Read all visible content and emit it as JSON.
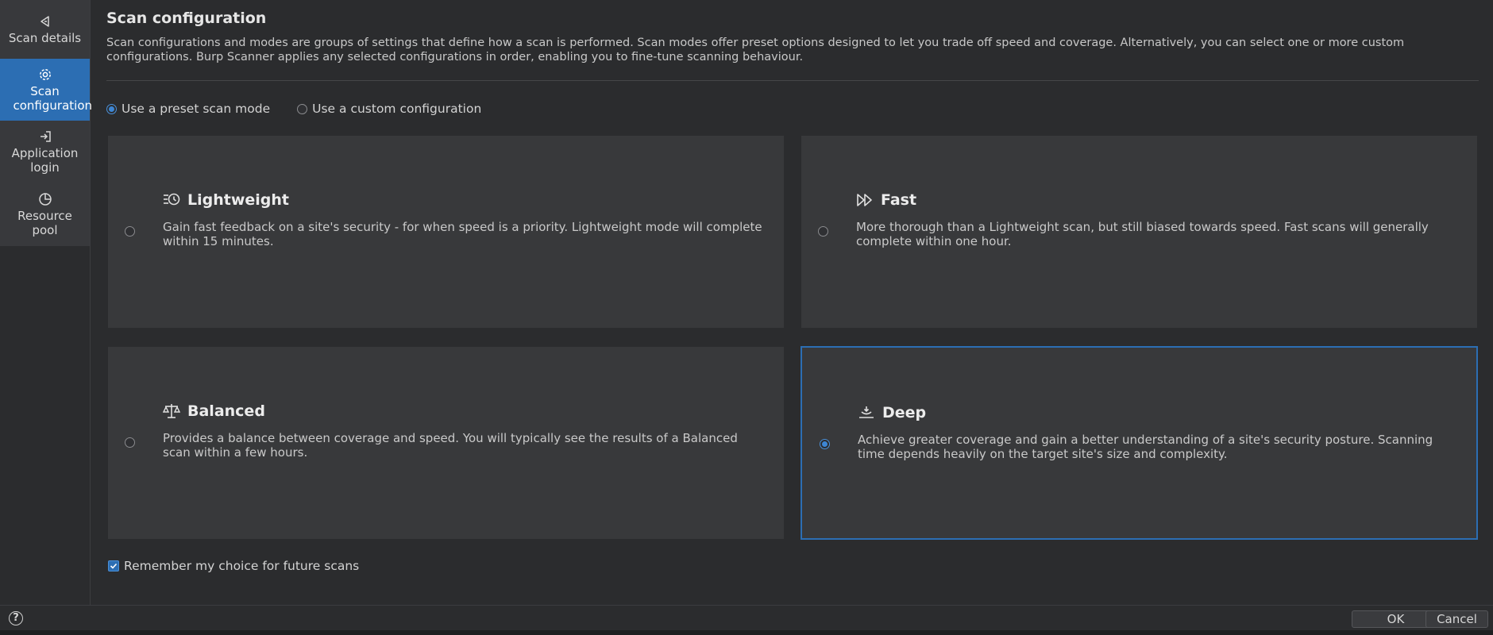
{
  "sidebar": {
    "items": [
      {
        "label": "Scan details",
        "icon": "scan-details-icon"
      },
      {
        "label": "Scan configuration",
        "icon": "gear-icon"
      },
      {
        "label": "Application login",
        "icon": "login-icon"
      },
      {
        "label": "Resource pool",
        "icon": "pie-chart-icon"
      }
    ],
    "active_index": 1
  },
  "main": {
    "title": "Scan configuration",
    "description": "Scan configurations and modes are groups of settings that define how a scan is performed. Scan modes offer preset options designed to let you trade off speed and coverage. Alternatively, you can select one or more custom configurations. Burp Scanner applies any selected configurations in order, enabling you to fine-tune scanning behaviour.",
    "mode_options": {
      "preset": "Use a preset scan mode",
      "custom": "Use a custom configuration",
      "selected": "preset"
    },
    "cards": [
      {
        "title": "Lightweight",
        "icon": "clock-list-icon",
        "description": "Gain fast feedback on a site's security - for when speed is a priority. Lightweight mode will complete within 15 minutes.",
        "selected": false
      },
      {
        "title": "Fast",
        "icon": "fast-forward-icon",
        "description": "More thorough than a Lightweight scan, but still biased towards speed. Fast scans will generally complete within one hour.",
        "selected": false
      },
      {
        "title": "Balanced",
        "icon": "scales-icon",
        "description": "Provides a balance between coverage and speed. You will typically see the results of a Balanced scan within a few hours.",
        "selected": false
      },
      {
        "title": "Deep",
        "icon": "deep-dive-icon",
        "description": "Achieve greater coverage and gain a better understanding of a site's security posture. Scanning time depends heavily on the target site's size and complexity.",
        "selected": true
      }
    ],
    "remember": {
      "label": "Remember my choice for future scans",
      "checked": true
    }
  },
  "footer": {
    "help": "?",
    "ok": "OK",
    "cancel": "Cancel"
  },
  "colors": {
    "accent": "#2c6eb3",
    "background": "#2b2c2e",
    "card": "#38393b"
  }
}
